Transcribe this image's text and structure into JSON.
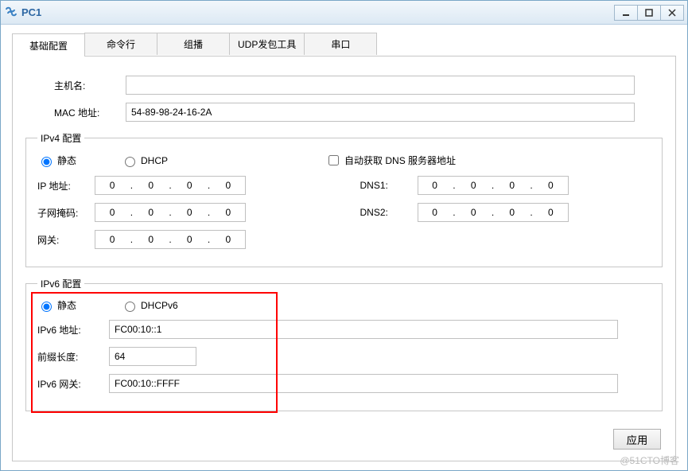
{
  "window": {
    "title": "PC1"
  },
  "tabs": {
    "t0": "基础配置",
    "t1": "命令行",
    "t2": "组播",
    "t3": "UDP发包工具",
    "t4": "串口"
  },
  "basic": {
    "host_label": "主机名:",
    "host_value": "",
    "mac_label": "MAC 地址:",
    "mac_value": "54-89-98-24-16-2A"
  },
  "ipv4": {
    "legend": "IPv4 配置",
    "static_label": "静态",
    "dhcp_label": "DHCP",
    "auto_dns_label": "自动获取 DNS 服务器地址",
    "ip_label": "IP 地址:",
    "mask_label": "子网掩码:",
    "gw_label": "网关:",
    "dns1_label": "DNS1:",
    "dns2_label": "DNS2:",
    "ip": {
      "o1": "0",
      "o2": "0",
      "o3": "0",
      "o4": "0"
    },
    "mask": {
      "o1": "0",
      "o2": "0",
      "o3": "0",
      "o4": "0"
    },
    "gw": {
      "o1": "0",
      "o2": "0",
      "o3": "0",
      "o4": "0"
    },
    "dns1": {
      "o1": "0",
      "o2": "0",
      "o3": "0",
      "o4": "0"
    },
    "dns2": {
      "o1": "0",
      "o2": "0",
      "o3": "0",
      "o4": "0"
    }
  },
  "ipv6": {
    "legend": "IPv6 配置",
    "static_label": "静态",
    "dhcp_label": "DHCPv6",
    "addr_label": "IPv6 地址:",
    "addr_value": "FC00:10::1",
    "prefix_label": "前缀长度:",
    "prefix_value": "64",
    "gw_label": "IPv6 网关:",
    "gw_value": "FC00:10::FFFF"
  },
  "buttons": {
    "apply": "应用"
  },
  "watermark": "@51CTO博客"
}
